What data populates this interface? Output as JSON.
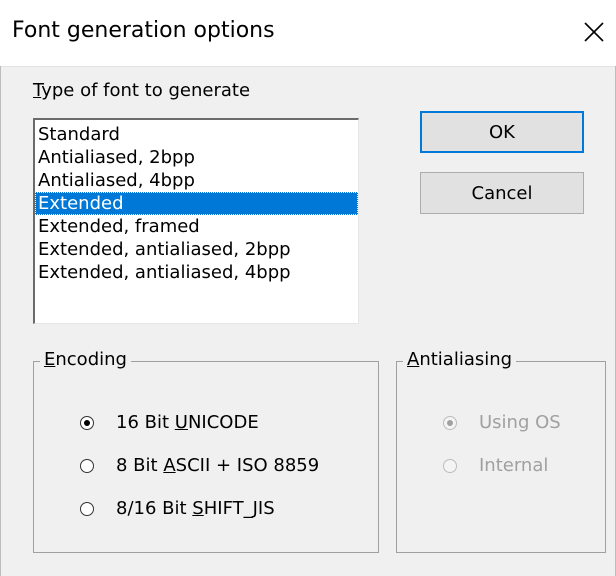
{
  "window": {
    "title": "Font generation options",
    "close_glyph": "✕"
  },
  "font_type": {
    "label_accel": "T",
    "label_rest": "ype of font to generate",
    "items": [
      "Standard",
      "Antialiased, 2bpp",
      "Antialiased, 4bpp",
      "Extended",
      "Extended, framed",
      "Extended, antialiased, 2bpp",
      "Extended, antialiased, 4bpp"
    ],
    "selected_index": 3
  },
  "buttons": {
    "ok": "OK",
    "cancel": "Cancel"
  },
  "encoding": {
    "title_accel": "E",
    "title_rest": "ncoding",
    "options": [
      {
        "pre": "16 Bit ",
        "accel": "U",
        "post": "NICODE",
        "checked": true
      },
      {
        "pre": "8 Bit ",
        "accel": "A",
        "post": "SCII + ISO 8859",
        "checked": false
      },
      {
        "pre": "8/16 Bit ",
        "accel": "S",
        "post": "HIFT_JIS",
        "checked": false
      }
    ]
  },
  "antialiasing": {
    "title_accel": "A",
    "title_rest": "ntialiasing",
    "options": [
      {
        "label": "Using OS",
        "checked": true,
        "disabled": true
      },
      {
        "label": "Internal",
        "checked": false,
        "disabled": true
      }
    ]
  }
}
